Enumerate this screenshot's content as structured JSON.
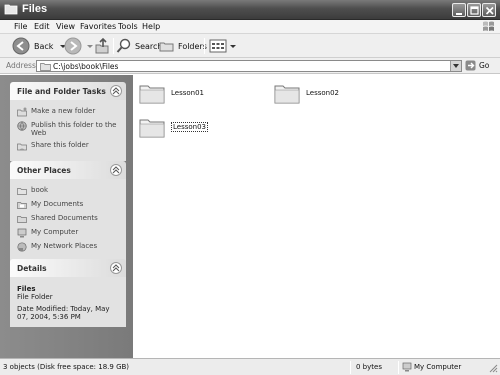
{
  "window": {
    "title": "Files"
  },
  "menu": {
    "items": [
      {
        "label": "File"
      },
      {
        "label": "Edit"
      },
      {
        "label": "View"
      },
      {
        "label": "Favorites"
      },
      {
        "label": "Tools"
      },
      {
        "label": "Help"
      }
    ]
  },
  "toolbar": {
    "back_label": "Back",
    "search_label": "Search",
    "folders_label": "Folders"
  },
  "address": {
    "label": "Address",
    "path": "C:\\jobs\\book\\Files",
    "go_label": "Go"
  },
  "sidebar": {
    "tasks": {
      "title": "File and Folder Tasks",
      "items": [
        {
          "label": "Make a new folder",
          "icon": "new-folder-icon"
        },
        {
          "label": "Publish this folder to the Web",
          "icon": "globe-icon"
        },
        {
          "label": "Share this folder",
          "icon": "share-icon"
        }
      ]
    },
    "places": {
      "title": "Other Places",
      "items": [
        {
          "label": "book",
          "icon": "folder-icon"
        },
        {
          "label": "My Documents",
          "icon": "documents-icon"
        },
        {
          "label": "Shared Documents",
          "icon": "shared-folder-icon"
        },
        {
          "label": "My Computer",
          "icon": "computer-icon"
        },
        {
          "label": "My Network Places",
          "icon": "network-icon"
        }
      ]
    },
    "details": {
      "title": "Details",
      "name": "Files",
      "type": "File Folder",
      "modified": "Date Modified: Today, May 07, 2004, 5:36 PM"
    }
  },
  "content": {
    "folders": [
      {
        "name": "Lesson01",
        "selected": false
      },
      {
        "name": "Lesson02",
        "selected": false
      },
      {
        "name": "Lesson03",
        "selected": true
      }
    ]
  },
  "status": {
    "objects": "3 objects (Disk free space: 18.9 GB)",
    "size": "0 bytes",
    "location": "My Computer"
  }
}
